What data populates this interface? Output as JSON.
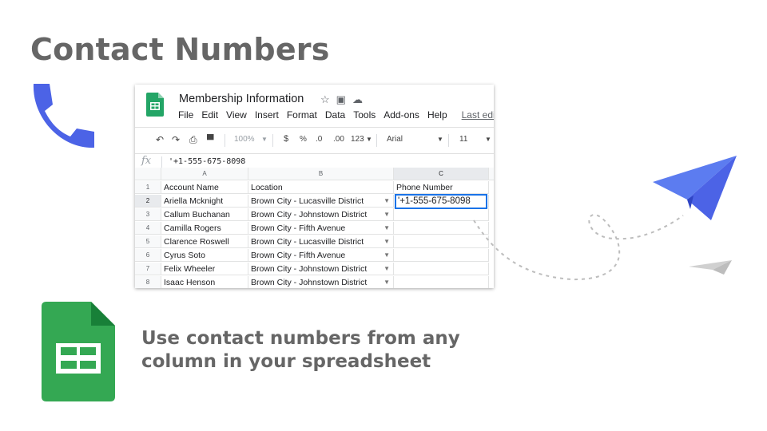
{
  "slide": {
    "title": "Contact Numbers",
    "tagline_line1": "Use contact numbers from any",
    "tagline_line2": "column in your spreadsheet",
    "title_color": "#666666",
    "accent_blue": "#4c63e6",
    "sheets_green": "#34a853"
  },
  "spreadsheet": {
    "doc_title": "Membership Information",
    "menu": [
      "File",
      "Edit",
      "View",
      "Insert",
      "Format",
      "Data",
      "Tools",
      "Add-ons",
      "Help"
    ],
    "last_edit": "Last edi",
    "toolbar": {
      "zoom": "100%",
      "currency": "$",
      "percent": "%",
      "decrease_decimal": ".0",
      "increase_decimal": ".00",
      "more_formats": "123",
      "font": "Arial",
      "font_size": "11"
    },
    "formula_value": "'+1-555-675-8098",
    "columns": [
      "A",
      "B",
      "C"
    ],
    "rows": [
      {
        "num": "1",
        "account": "Account Name",
        "location": "Location",
        "phone": "Phone Number"
      },
      {
        "num": "2",
        "account": "Ariella Mcknight",
        "location": "Brown City - Lucasville District",
        "phone": ""
      },
      {
        "num": "3",
        "account": "Callum Buchanan",
        "location": "Brown City - Johnstown District",
        "phone": ""
      },
      {
        "num": "4",
        "account": "Camilla Rogers",
        "location": "Brown City - Fifth Avenue",
        "phone": ""
      },
      {
        "num": "5",
        "account": "Clarence Roswell",
        "location": "Brown City - Lucasville District",
        "phone": ""
      },
      {
        "num": "6",
        "account": "Cyrus Soto",
        "location": "Brown City - Fifth Avenue",
        "phone": ""
      },
      {
        "num": "7",
        "account": "Felix Wheeler",
        "location": "Brown City - Johnstown District",
        "phone": ""
      },
      {
        "num": "8",
        "account": "Isaac Henson",
        "location": "Brown City - Johnstown District",
        "phone": ""
      }
    ],
    "active_cell_value": "'+1-555-675-8098"
  },
  "icons": {
    "phone": "phone-icon",
    "sheets": "google-sheets-icon",
    "plane": "paper-plane-icon"
  }
}
